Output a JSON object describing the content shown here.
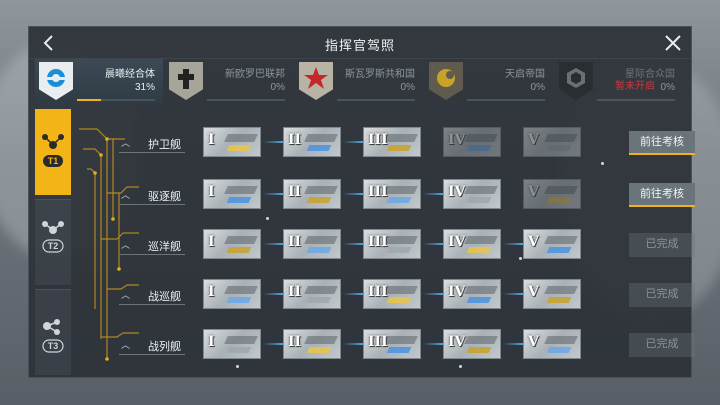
{
  "window": {
    "title": "指挥官驾照"
  },
  "factions": [
    {
      "name": "晨曦经合体",
      "progress_text": "31%",
      "progress": 0.31,
      "active": true,
      "emblem_color": "#1b8fd6",
      "locked_text": ""
    },
    {
      "name": "新欧罗巴联邦",
      "progress_text": "0%",
      "progress": 0,
      "active": false,
      "emblem_color": "#222222",
      "locked_text": ""
    },
    {
      "name": "斯瓦罗斯共和国",
      "progress_text": "0%",
      "progress": 0,
      "active": false,
      "emblem_color": "#c42828",
      "locked_text": ""
    },
    {
      "name": "天启帝国",
      "progress_text": "0%",
      "progress": 0,
      "active": false,
      "emblem_color": "#c9a227",
      "locked_text": ""
    },
    {
      "name": "星际合众国",
      "progress_text": "0%",
      "progress": 0,
      "active": false,
      "emblem_color": "#3a3f44",
      "locked_text": "暂未开启"
    }
  ],
  "tiers": [
    {
      "label": "T1",
      "active": true
    },
    {
      "label": "T2",
      "active": false
    },
    {
      "label": "T3",
      "active": false
    }
  ],
  "ships": [
    {
      "name": "护卫舰",
      "levels": [
        "I",
        "II",
        "III",
        "IV",
        "V"
      ],
      "unlocked": 3,
      "action": "前往考核",
      "action_state": "go"
    },
    {
      "name": "驱逐舰",
      "levels": [
        "I",
        "II",
        "III",
        "IV",
        "V"
      ],
      "unlocked": 4,
      "action": "前往考核",
      "action_state": "go"
    },
    {
      "name": "巡洋舰",
      "levels": [
        "I",
        "II",
        "III",
        "IV",
        "V"
      ],
      "unlocked": 5,
      "action": "已完成",
      "action_state": "done"
    },
    {
      "name": "战巡舰",
      "levels": [
        "I",
        "II",
        "III",
        "IV",
        "V"
      ],
      "unlocked": 5,
      "action": "已完成",
      "action_state": "done"
    },
    {
      "name": "战列舰",
      "levels": [
        "I",
        "II",
        "III",
        "IV",
        "V"
      ],
      "unlocked": 5,
      "action": "已完成",
      "action_state": "done"
    }
  ],
  "colors": {
    "accent": "#f2b21b",
    "link_arrow": "#56b3f0",
    "locked": "#d8333b"
  }
}
